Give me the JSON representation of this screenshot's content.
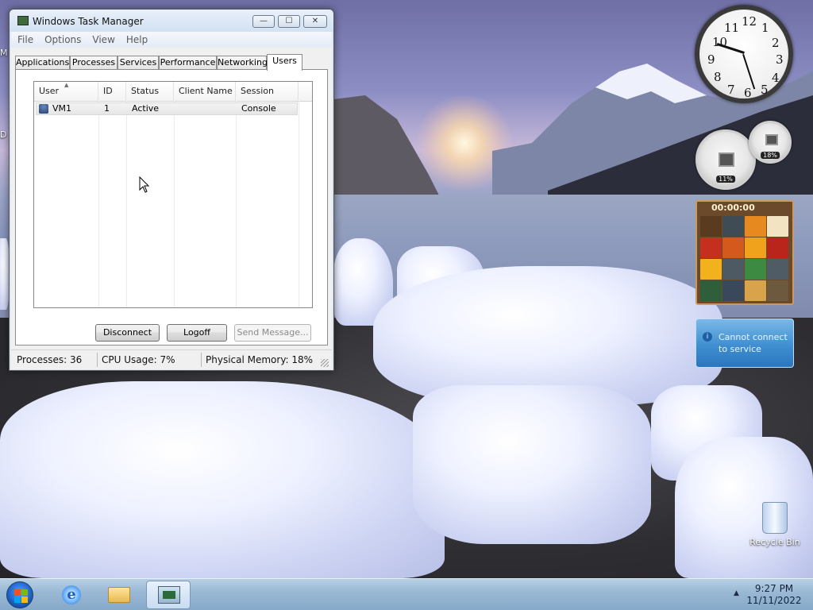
{
  "desktop": {
    "left_cut_1": "M",
    "left_cut_2": "D",
    "recycle_bin_label": "Recycle Bin"
  },
  "gadgets": {
    "clock": {
      "numbers": [
        "12",
        "1",
        "2",
        "3",
        "4",
        "5",
        "6",
        "7",
        "8",
        "9",
        "10",
        "11"
      ],
      "time": "9:27"
    },
    "cpu_meter": {
      "cpu_percent_label": "11%",
      "memory_percent_label": "18%",
      "cpu": 11,
      "memory": 18
    },
    "puzzle": {
      "timer": "00:00:00"
    },
    "weather": {
      "message_line1": "Cannot connect",
      "message_line2": "to service"
    }
  },
  "window": {
    "title": "Windows Task Manager",
    "controls": {
      "minimize": "—",
      "maximize": "☐",
      "close": "✕"
    },
    "menu": [
      "File",
      "Options",
      "View",
      "Help"
    ],
    "tabs": [
      "Applications",
      "Processes",
      "Services",
      "Performance",
      "Networking",
      "Users"
    ],
    "active_tab": "Users",
    "users_table": {
      "columns": [
        "User",
        "ID",
        "Status",
        "Client Name",
        "Session"
      ],
      "rows": [
        {
          "user": "VM1",
          "id": "1",
          "status": "Active",
          "client_name": "",
          "session": "Console"
        }
      ]
    },
    "buttons": {
      "disconnect": "Disconnect",
      "logoff": "Logoff",
      "send_message": "Send Message..."
    },
    "status_bar": {
      "processes": "Processes: 36",
      "cpu_usage": "CPU Usage: 7%",
      "physical_memory": "Physical Memory: 18%"
    }
  },
  "taskbar": {
    "clock_time": "9:27 PM",
    "clock_date": "11/11/2022"
  },
  "colors": {
    "taskbar": "#98b7d3",
    "window_frame": "#dfe9f5",
    "weather_blue": "#3f8fd1"
  }
}
